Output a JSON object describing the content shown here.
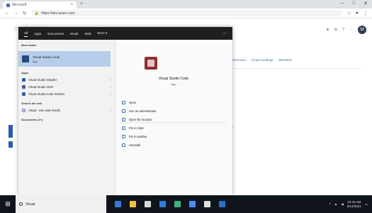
{
  "browser": {
    "tab_title": "Microsoft",
    "newtab_symbol": "+",
    "close_tab_symbol": "×",
    "window_controls": [
      "–",
      "□",
      "✕"
    ],
    "url": "https://dev.azure.com",
    "nav_icons": [
      "back-arrow-icon",
      "forward-arrow-icon",
      "reload-icon"
    ]
  },
  "page": {
    "header_items": [
      "★",
      "⚙",
      "?",
      "⋯"
    ],
    "avatar_initials": "U",
    "links": [
      "Overview",
      "Project settings",
      "Members"
    ]
  },
  "start_menu": {
    "top_tabs": [
      "All",
      "Apps",
      "Documents",
      "Email",
      "Web",
      "More ▾"
    ],
    "active_tab_index": 0,
    "more_symbol": "⋯",
    "best_match_label": "Best match",
    "best_match": {
      "title": "Visual Studio Code",
      "subtitle": "App"
    },
    "apps_label": "Apps",
    "apps": [
      {
        "label": "Visual Studio Installer",
        "arrow": "›"
      },
      {
        "label": "Visual Studio 2019",
        "arrow": "›"
      },
      {
        "label": "Visual Studio Code Insiders",
        "arrow": "›"
      }
    ],
    "search_web_label": "Search the web",
    "web_result": {
      "label": "Visual - See web results",
      "arrow": "›"
    },
    "documents_label": "Documents (1+)",
    "detail": {
      "title": "Visual Studio Code",
      "subtitle": "App",
      "actions": [
        "Open",
        "Run as administrator",
        "Open file location",
        "Pin to Start",
        "Pin to taskbar",
        "Uninstall"
      ]
    }
  },
  "taskbar": {
    "start_symbol": "⊞",
    "search_text": "Visual",
    "tray_chevron": "^",
    "time": "10:42 AM",
    "date": "6/14/2021",
    "pinned_icon_colors": [
      "#3a78d6",
      "#f0c23a",
      "#d9d9d9",
      "#2f7be0",
      "#3fb27f",
      "#4c8bf5",
      "#e0e0e0",
      "#2a72c9"
    ]
  }
}
